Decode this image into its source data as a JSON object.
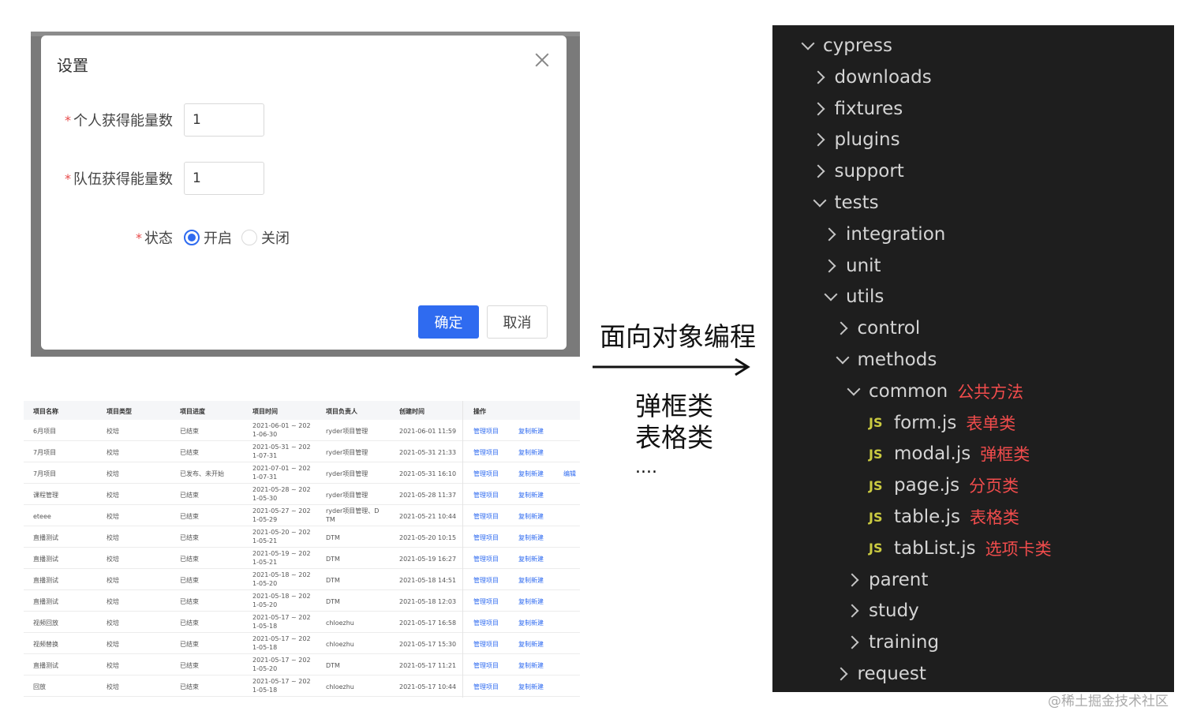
{
  "modal": {
    "title": "设置",
    "fields": [
      {
        "label": "个人获得能量数",
        "value": "1"
      },
      {
        "label": "队伍获得能量数",
        "value": "1"
      }
    ],
    "status_label": "状态",
    "status_options": [
      "开启",
      "关闭"
    ],
    "status_selected": "开启",
    "ok_label": "确定",
    "cancel_label": "取消"
  },
  "table": {
    "headers": [
      "项目名称",
      "项目类型",
      "项目进度",
      "项目时间",
      "项目负责人",
      "创建时间",
      "操作"
    ],
    "rows": [
      {
        "name": "6月项目",
        "type": "校培",
        "progress": "已结束",
        "time1": "2021-06-01 ~ 202",
        "time2": "1-06-30",
        "owner": "ryder项目管理",
        "owner2": "",
        "created": "2021-06-01 11:59",
        "ops": [
          "管理项目",
          "复制新建"
        ]
      },
      {
        "name": "7月项目",
        "type": "校培",
        "progress": "已结束",
        "time1": "2021-05-31 ~ 202",
        "time2": "1-07-31",
        "owner": "ryder项目管理",
        "owner2": "",
        "created": "2021-05-31 21:33",
        "ops": [
          "管理项目",
          "复制新建"
        ]
      },
      {
        "name": "7月项目",
        "type": "校培",
        "progress": "已发布、未开始",
        "time1": "2021-07-01 ~ 202",
        "time2": "1-07-31",
        "owner": "ryder项目管理",
        "owner2": "",
        "created": "2021-05-31 16:10",
        "ops": [
          "管理项目",
          "复制新建",
          "编辑"
        ]
      },
      {
        "name": "课程管理",
        "type": "校培",
        "progress": "已结束",
        "time1": "2021-05-28 ~ 202",
        "time2": "1-05-30",
        "owner": "ryder项目管理",
        "owner2": "",
        "created": "2021-05-28 11:37",
        "ops": [
          "管理项目",
          "复制新建"
        ]
      },
      {
        "name": "eteee",
        "type": "校培",
        "progress": "已结束",
        "time1": "2021-05-27 ~ 202",
        "time2": "1-05-29",
        "owner": "ryder项目管理、D",
        "owner2": "TM",
        "created": "2021-05-21 10:44",
        "ops": [
          "管理项目",
          "复制新建"
        ]
      },
      {
        "name": "直播测试",
        "type": "校培",
        "progress": "已结束",
        "time1": "2021-05-20 ~ 202",
        "time2": "1-05-21",
        "owner": "DTM",
        "owner2": "",
        "created": "2021-05-20 10:15",
        "ops": [
          "管理项目",
          "复制新建"
        ]
      },
      {
        "name": "直播测试",
        "type": "校培",
        "progress": "已结束",
        "time1": "2021-05-19 ~ 202",
        "time2": "1-05-21",
        "owner": "DTM",
        "owner2": "",
        "created": "2021-05-19 16:27",
        "ops": [
          "管理项目",
          "复制新建"
        ]
      },
      {
        "name": "直播测试",
        "type": "校培",
        "progress": "已结束",
        "time1": "2021-05-18 ~ 202",
        "time2": "1-05-20",
        "owner": "DTM",
        "owner2": "",
        "created": "2021-05-18 14:51",
        "ops": [
          "管理项目",
          "复制新建"
        ]
      },
      {
        "name": "直播测试",
        "type": "校培",
        "progress": "已结束",
        "time1": "2021-05-18 ~ 202",
        "time2": "1-05-20",
        "owner": "DTM",
        "owner2": "",
        "created": "2021-05-18 12:03",
        "ops": [
          "管理项目",
          "复制新建"
        ]
      },
      {
        "name": "视频回放",
        "type": "校培",
        "progress": "已结束",
        "time1": "2021-05-17 ~ 202",
        "time2": "1-05-18",
        "owner": "chloezhu",
        "owner2": "",
        "created": "2021-05-17 16:58",
        "ops": [
          "管理项目",
          "复制新建"
        ]
      },
      {
        "name": "视频替换",
        "type": "校培",
        "progress": "已结束",
        "time1": "2021-05-17 ~ 202",
        "time2": "1-05-18",
        "owner": "chloezhu",
        "owner2": "",
        "created": "2021-05-17 15:30",
        "ops": [
          "管理项目",
          "复制新建"
        ]
      },
      {
        "name": "直播测试",
        "type": "校培",
        "progress": "已结束",
        "time1": "2021-05-17 ~ 202",
        "time2": "1-05-20",
        "owner": "DTM",
        "owner2": "",
        "created": "2021-05-17 11:21",
        "ops": [
          "管理项目",
          "复制新建"
        ]
      },
      {
        "name": "回放",
        "type": "校培",
        "progress": "已结束",
        "time1": "2021-05-17 ~ 202",
        "time2": "1-05-18",
        "owner": "chloezhu",
        "owner2": "",
        "created": "2021-05-17 10:44",
        "ops": [
          "管理项目",
          "复制新建"
        ]
      }
    ]
  },
  "middle": {
    "title": "面向对象编程",
    "lines": [
      "弹框类",
      "表格类"
    ],
    "ellipsis": "...."
  },
  "tree": {
    "nodes": [
      {
        "label": "cypress",
        "chevron": "down",
        "depth": 0
      },
      {
        "label": "downloads",
        "chevron": "right",
        "depth": 1
      },
      {
        "label": "fixtures",
        "chevron": "right",
        "depth": 1
      },
      {
        "label": "plugins",
        "chevron": "right",
        "depth": 1
      },
      {
        "label": "support",
        "chevron": "right",
        "depth": 1
      },
      {
        "label": "tests",
        "chevron": "down",
        "depth": 1
      },
      {
        "label": "integration",
        "chevron": "right",
        "depth": 2
      },
      {
        "label": "unit",
        "chevron": "right",
        "depth": 2
      },
      {
        "label": "utils",
        "chevron": "down",
        "depth": 2
      },
      {
        "label": "control",
        "chevron": "right",
        "depth": 3
      },
      {
        "label": "methods",
        "chevron": "down",
        "depth": 3
      },
      {
        "label": "common",
        "chevron": "down",
        "depth": 4,
        "note": "公共方法"
      },
      {
        "label": "form.js",
        "file": "JS",
        "depth": 5,
        "note": "表单类"
      },
      {
        "label": "modal.js",
        "file": "JS",
        "depth": 5,
        "note": "弹框类"
      },
      {
        "label": "page.js",
        "file": "JS",
        "depth": 5,
        "note": "分页类"
      },
      {
        "label": "table.js",
        "file": "JS",
        "depth": 5,
        "note": "表格类"
      },
      {
        "label": "tabList.js",
        "file": "JS",
        "depth": 5,
        "note": "选项卡类"
      },
      {
        "label": "parent",
        "chevron": "right",
        "depth": 4
      },
      {
        "label": "study",
        "chevron": "right",
        "depth": 4
      },
      {
        "label": "training",
        "chevron": "right",
        "depth": 4
      },
      {
        "label": "request",
        "chevron": "right",
        "depth": 3
      }
    ]
  },
  "colors": {
    "primary": "#2f6bf0",
    "required": "#e84a4a",
    "tree_bg": "#1e1e1e",
    "tree_text": "#d4d4d4",
    "js_badge": "#cbcb41",
    "note_red": "#f14c4c"
  },
  "watermark": "@稀土掘金技术社区"
}
